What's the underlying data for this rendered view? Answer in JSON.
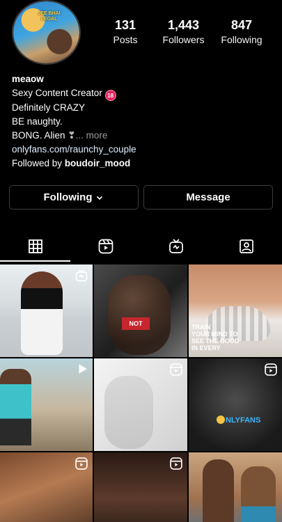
{
  "profile": {
    "avatar_text": "JEE BHAI LEGAL",
    "posts_count": "131",
    "posts_label": "Posts",
    "followers_count": "1,443",
    "followers_label": "Followers",
    "following_count": "847",
    "following_label": "Following",
    "name": "meaow",
    "bio_line1": "Sexy Content Creator",
    "badge": "18",
    "bio_line2": "Definitely CRAZY",
    "bio_line3": "BE naughty.",
    "bio_line4": "BONG. Alien",
    "bio_line4_emoji": "❣",
    "more_label": "... more",
    "link": "onlyfans.com/raunchy_couple",
    "followed_by_prefix": "Followed by",
    "followed_by_user": "boudoir_mood"
  },
  "actions": {
    "following_label": "Following",
    "message_label": "Message"
  },
  "tabs": [
    {
      "icon": "grid-icon",
      "active": true
    },
    {
      "icon": "reels-icon",
      "active": false
    },
    {
      "icon": "igtv-icon",
      "active": false
    },
    {
      "icon": "tagged-icon",
      "active": false
    }
  ],
  "grid": {
    "cell3_caption": "TRAIN\nYOUR MIND TO\nSEE THE GOOD\nIN EVERY",
    "cell6_brand": "NLYFANS",
    "cells": [
      {
        "type": "igtv"
      },
      {
        "type": "none"
      },
      {
        "type": "none"
      },
      {
        "type": "video"
      },
      {
        "type": "reel"
      },
      {
        "type": "reel"
      },
      {
        "type": "reel"
      },
      {
        "type": "reel"
      },
      {
        "type": "none"
      }
    ]
  },
  "colors": {
    "background": "#000000",
    "badge": "#e0245e",
    "border": "#3c3c3c"
  }
}
